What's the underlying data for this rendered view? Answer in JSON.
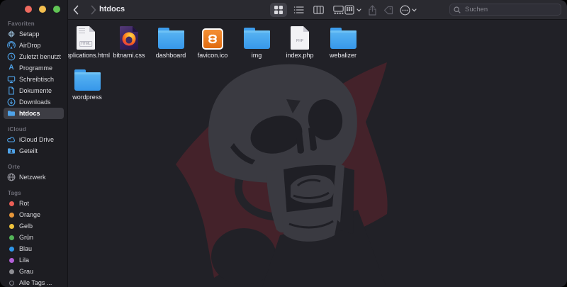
{
  "window": {
    "title": "htdocs"
  },
  "titlebar": {
    "traffic_lights": [
      "close-button",
      "minimize-button",
      "zoom-button"
    ]
  },
  "toolbar": {
    "back_icon": "chevron-left",
    "forward_icon": "chevron-right",
    "view_mode_icons": [
      "grid-view-icon",
      "list-view-icon",
      "columns-view-icon",
      "gallery-view-icon"
    ],
    "selected_view": "grid-view-icon",
    "action_icons": [
      "group-icon",
      "share-icon",
      "tag-icon",
      "more-icon"
    ],
    "search": {
      "icon": "search-icon",
      "placeholder": "Suchen",
      "value": ""
    }
  },
  "icons": {
    "applications_glyph": "A"
  },
  "sidebar": {
    "sections": [
      {
        "label": "Favoriten",
        "items": [
          {
            "label": "Setapp",
            "icon": "setapp-icon"
          },
          {
            "label": "AirDrop",
            "icon": "airdrop-icon"
          },
          {
            "label": "Zuletzt benutzt",
            "icon": "clock-icon"
          },
          {
            "label": "Programme",
            "icon": "applications-icon"
          },
          {
            "label": "Schreibtisch",
            "icon": "desktop-icon"
          },
          {
            "label": "Dokumente",
            "icon": "document-icon"
          },
          {
            "label": "Downloads",
            "icon": "downloads-icon"
          },
          {
            "label": "htdocs",
            "icon": "folder-icon",
            "selected": true
          }
        ]
      },
      {
        "label": "iCloud",
        "items": [
          {
            "label": "iCloud Drive",
            "icon": "cloud-icon"
          },
          {
            "label": "Geteilt",
            "icon": "shared-folder-icon"
          }
        ]
      },
      {
        "label": "Orte",
        "items": [
          {
            "label": "Netzwerk",
            "icon": "globe-icon"
          }
        ]
      },
      {
        "label": "Tags",
        "items": [
          {
            "label": "Rot",
            "color": "#ec5f57"
          },
          {
            "label": "Orange",
            "color": "#e8973a"
          },
          {
            "label": "Gelb",
            "color": "#f0c33c"
          },
          {
            "label": "Grün",
            "color": "#53b558"
          },
          {
            "label": "Blau",
            "color": "#2e95e8"
          },
          {
            "label": "Lila",
            "color": "#b460d8"
          },
          {
            "label": "Grau",
            "color": "#8e8e93"
          },
          {
            "label": "Alle Tags ...",
            "color": ""
          }
        ]
      }
    ]
  },
  "files": [
    {
      "name": "applications.html",
      "type": "html-document",
      "badge": "HTML"
    },
    {
      "name": "bitnami.css",
      "type": "css-document-firefox"
    },
    {
      "name": "dashboard",
      "type": "folder"
    },
    {
      "name": "favicon.ico",
      "type": "xampp-image"
    },
    {
      "name": "img",
      "type": "folder"
    },
    {
      "name": "index.php",
      "type": "php-document",
      "badge": "PHP"
    },
    {
      "name": "webalizer",
      "type": "folder"
    },
    {
      "name": "wordpress",
      "type": "folder"
    }
  ],
  "colors": {
    "accent_blue": "#4fa3e9",
    "folder_blue": "#43a3ee",
    "xampp_orange": "#ee7b1e",
    "skull_gray": "#3a3a41",
    "burst_red": "#44222a",
    "selection_gray": "#3d3d44",
    "content_bg": "#212127",
    "sidebar_bg": "#1d1d22",
    "toolbar_bg": "#2a2a30"
  }
}
